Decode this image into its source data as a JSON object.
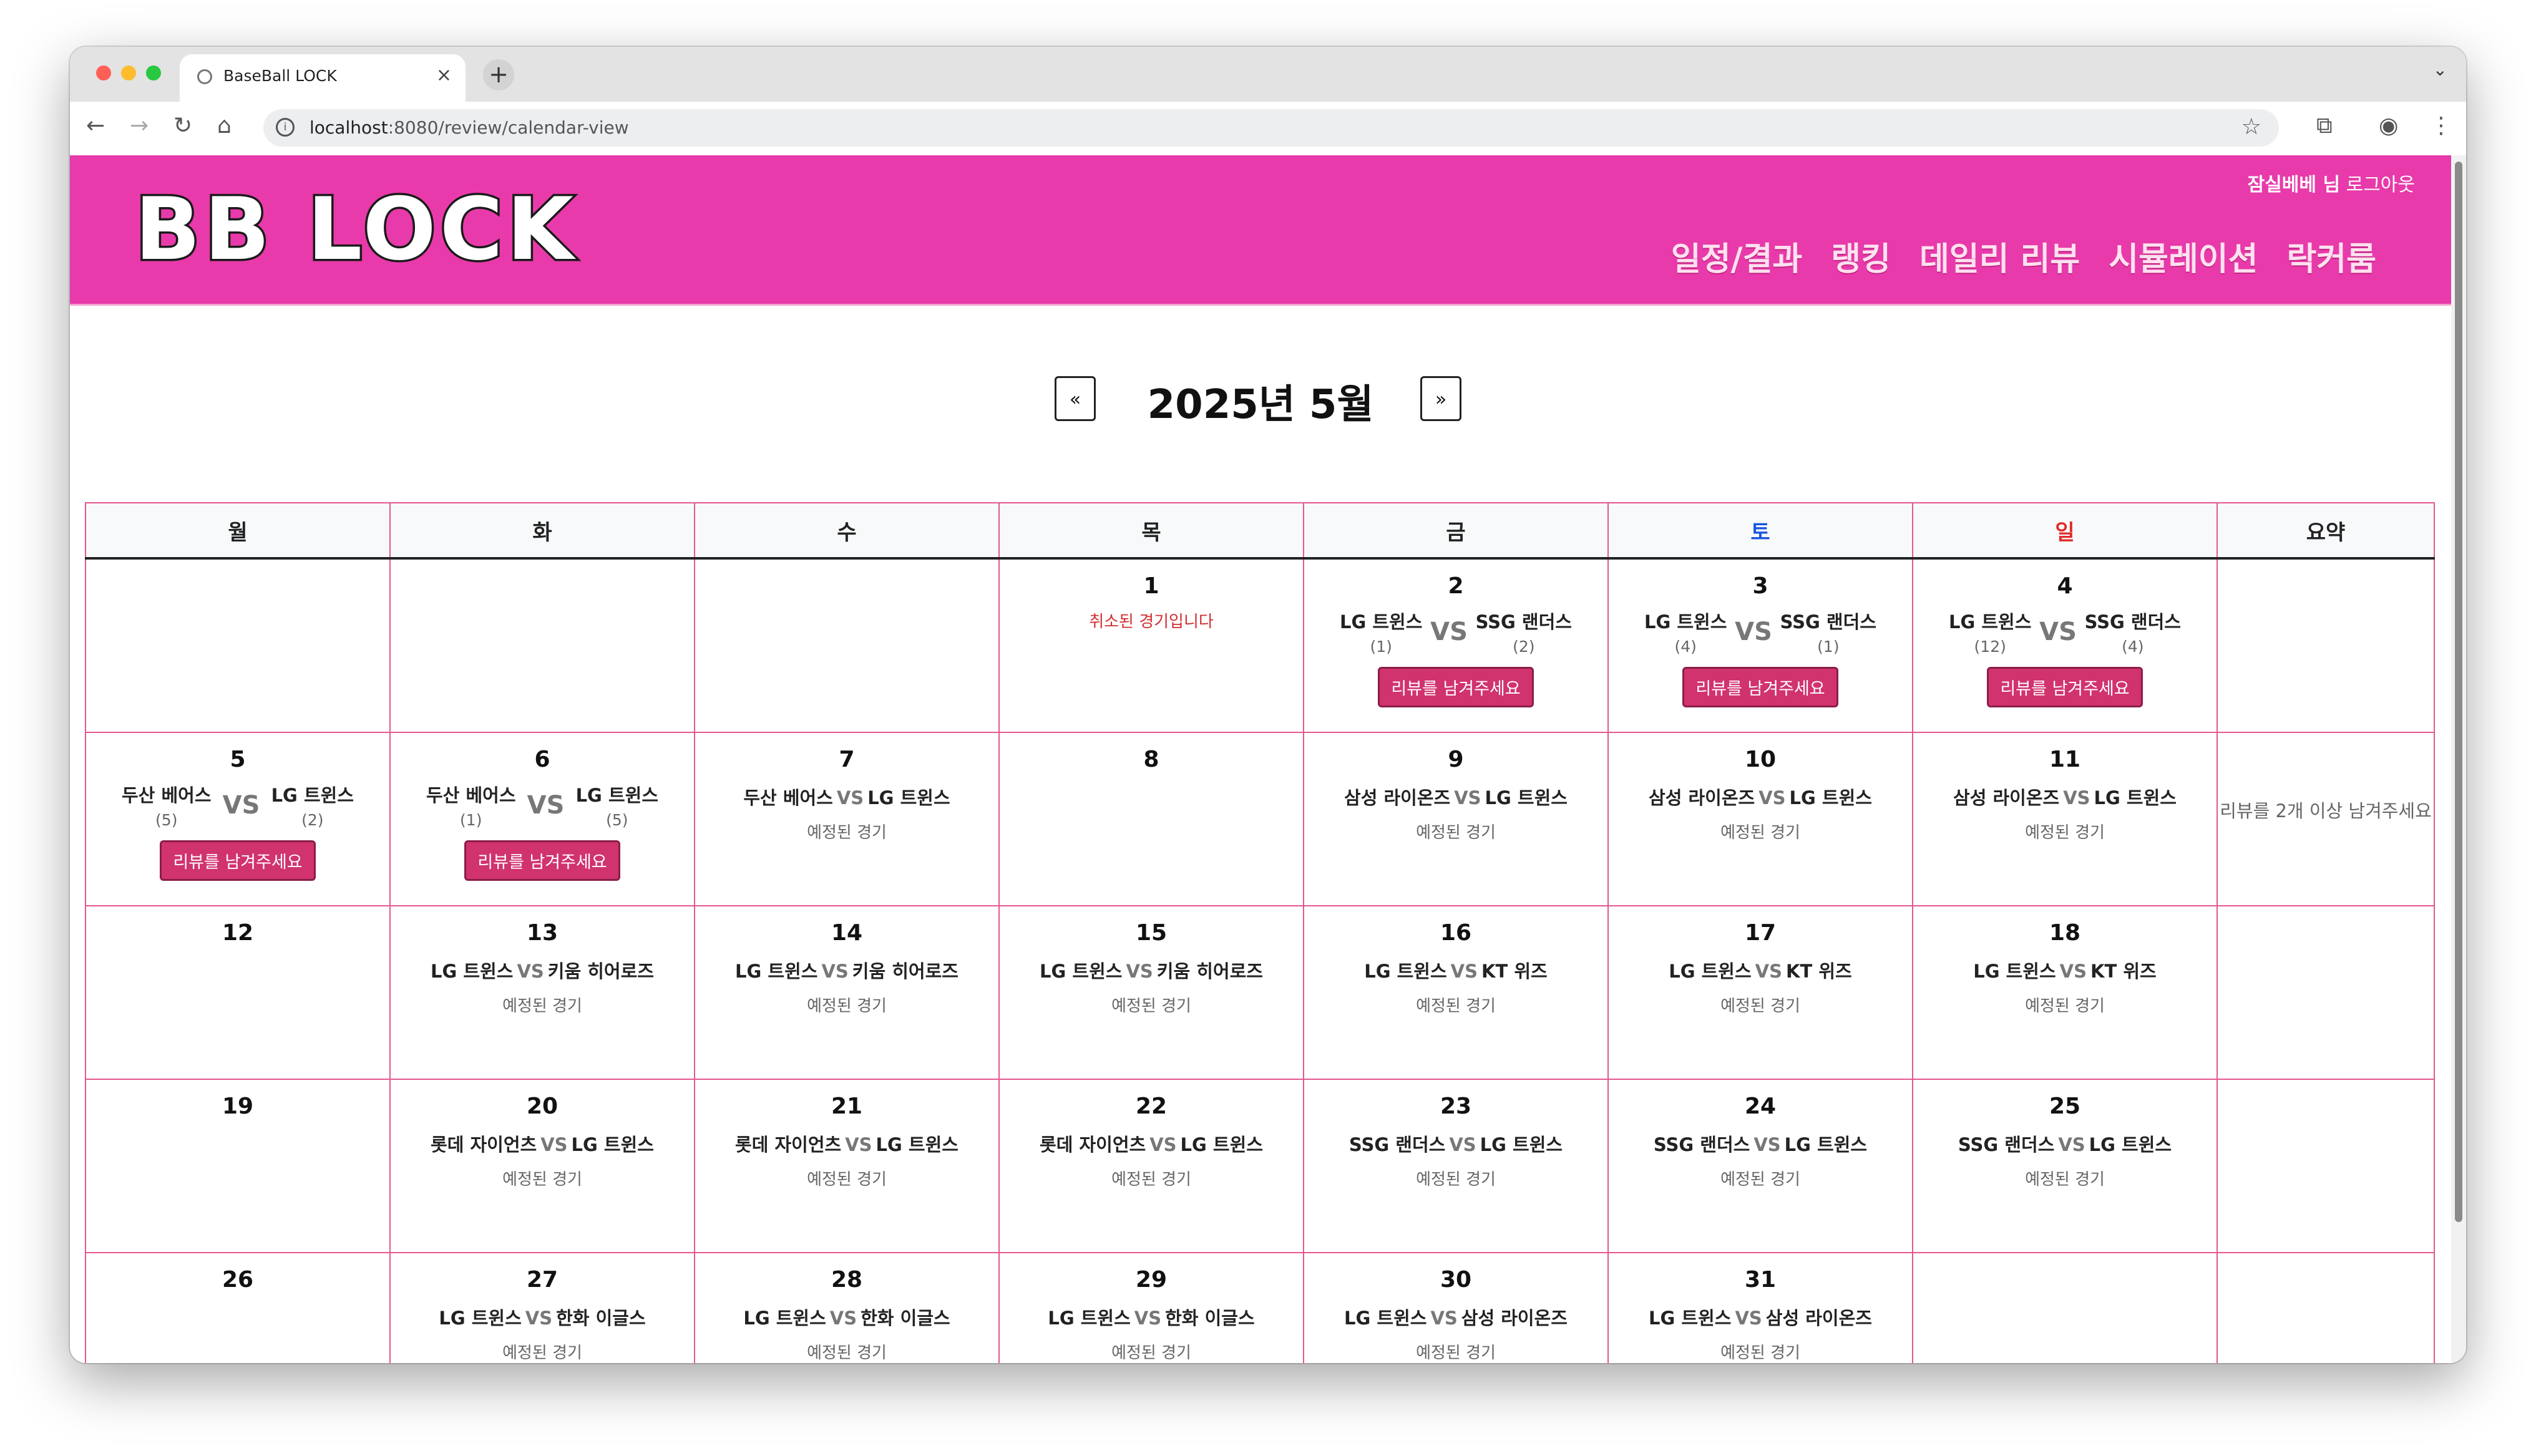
{
  "browser": {
    "tab_title": "BaseBall LOCK",
    "url_host": "localhost",
    "url_rest": ":8080/review/calendar-view"
  },
  "header": {
    "logo": "BB LOCK",
    "user_name": "잠실베베 님",
    "logout": "로그아웃",
    "menu": [
      "일정/결과",
      "랭킹",
      "데일리 리뷰",
      "시뮬레이션",
      "락커룸"
    ]
  },
  "month_nav": {
    "prev": "«",
    "title": "2025년 5월",
    "next": "»"
  },
  "calendar": {
    "weekdays": [
      "월",
      "화",
      "수",
      "목",
      "금",
      "토",
      "일",
      "요약"
    ],
    "vs": "VS",
    "scheduled_label": "예정된 경기",
    "cancelled_label": "취소된 경기입니다",
    "review_button": "리뷰를 남겨주세요",
    "weeks": [
      {
        "days": [
          null,
          null,
          null,
          {
            "day": "1",
            "type": "cancelled"
          },
          {
            "day": "2",
            "type": "result",
            "home": "LG 트윈스",
            "away": "SSG 랜더스",
            "home_score": "(1)",
            "away_score": "(2)"
          },
          {
            "day": "3",
            "type": "result",
            "home": "LG 트윈스",
            "away": "SSG 랜더스",
            "home_score": "(4)",
            "away_score": "(1)"
          },
          {
            "day": "4",
            "type": "result",
            "home": "LG 트윈스",
            "away": "SSG 랜더스",
            "home_score": "(12)",
            "away_score": "(4)"
          }
        ],
        "summary": ""
      },
      {
        "days": [
          {
            "day": "5",
            "type": "result",
            "home": "두산 베어스",
            "away": "LG 트윈스",
            "home_score": "(5)",
            "away_score": "(2)"
          },
          {
            "day": "6",
            "type": "result",
            "home": "두산 베어스",
            "away": "LG 트윈스",
            "home_score": "(1)",
            "away_score": "(5)"
          },
          {
            "day": "7",
            "type": "scheduled",
            "home": "두산 베어스",
            "away": "LG 트윈스"
          },
          {
            "day": "8",
            "type": "empty"
          },
          {
            "day": "9",
            "type": "scheduled",
            "home": "삼성 라이온즈",
            "away": "LG 트윈스"
          },
          {
            "day": "10",
            "type": "scheduled",
            "home": "삼성 라이온즈",
            "away": "LG 트윈스"
          },
          {
            "day": "11",
            "type": "scheduled",
            "home": "삼성 라이온즈",
            "away": "LG 트윈스"
          }
        ],
        "summary": "리뷰를 2개 이상 남겨주세요"
      },
      {
        "days": [
          {
            "day": "12",
            "type": "empty"
          },
          {
            "day": "13",
            "type": "scheduled",
            "home": "LG 트윈스",
            "away": "키움 히어로즈"
          },
          {
            "day": "14",
            "type": "scheduled",
            "home": "LG 트윈스",
            "away": "키움 히어로즈"
          },
          {
            "day": "15",
            "type": "scheduled",
            "home": "LG 트윈스",
            "away": "키움 히어로즈"
          },
          {
            "day": "16",
            "type": "scheduled",
            "home": "LG 트윈스",
            "away": "KT 위즈"
          },
          {
            "day": "17",
            "type": "scheduled",
            "home": "LG 트윈스",
            "away": "KT 위즈"
          },
          {
            "day": "18",
            "type": "scheduled",
            "home": "LG 트윈스",
            "away": "KT 위즈"
          }
        ],
        "summary": ""
      },
      {
        "days": [
          {
            "day": "19",
            "type": "empty"
          },
          {
            "day": "20",
            "type": "scheduled",
            "home": "롯데 자이언츠",
            "away": "LG 트윈스"
          },
          {
            "day": "21",
            "type": "scheduled",
            "home": "롯데 자이언츠",
            "away": "LG 트윈스"
          },
          {
            "day": "22",
            "type": "scheduled",
            "home": "롯데 자이언츠",
            "away": "LG 트윈스"
          },
          {
            "day": "23",
            "type": "scheduled",
            "home": "SSG 랜더스",
            "away": "LG 트윈스"
          },
          {
            "day": "24",
            "type": "scheduled",
            "home": "SSG 랜더스",
            "away": "LG 트윈스"
          },
          {
            "day": "25",
            "type": "scheduled",
            "home": "SSG 랜더스",
            "away": "LG 트윈스"
          }
        ],
        "summary": ""
      },
      {
        "days": [
          {
            "day": "26",
            "type": "empty"
          },
          {
            "day": "27",
            "type": "scheduled",
            "home": "LG 트윈스",
            "away": "한화 이글스"
          },
          {
            "day": "28",
            "type": "scheduled",
            "home": "LG 트윈스",
            "away": "한화 이글스"
          },
          {
            "day": "29",
            "type": "scheduled",
            "home": "LG 트윈스",
            "away": "한화 이글스"
          },
          {
            "day": "30",
            "type": "scheduled",
            "home": "LG 트윈스",
            "away": "삼성 라이온즈"
          },
          {
            "day": "31",
            "type": "scheduled",
            "home": "LG 트윈스",
            "away": "삼성 라이온즈"
          },
          null
        ],
        "summary": ""
      }
    ]
  },
  "colors": {
    "header_bg": "#e83aaa",
    "grid_border": "#e5568f",
    "review_button": "#d1336e",
    "saturday": "#1a56e0",
    "sunday": "#e02a2a",
    "cancelled": "#d22f2f"
  }
}
